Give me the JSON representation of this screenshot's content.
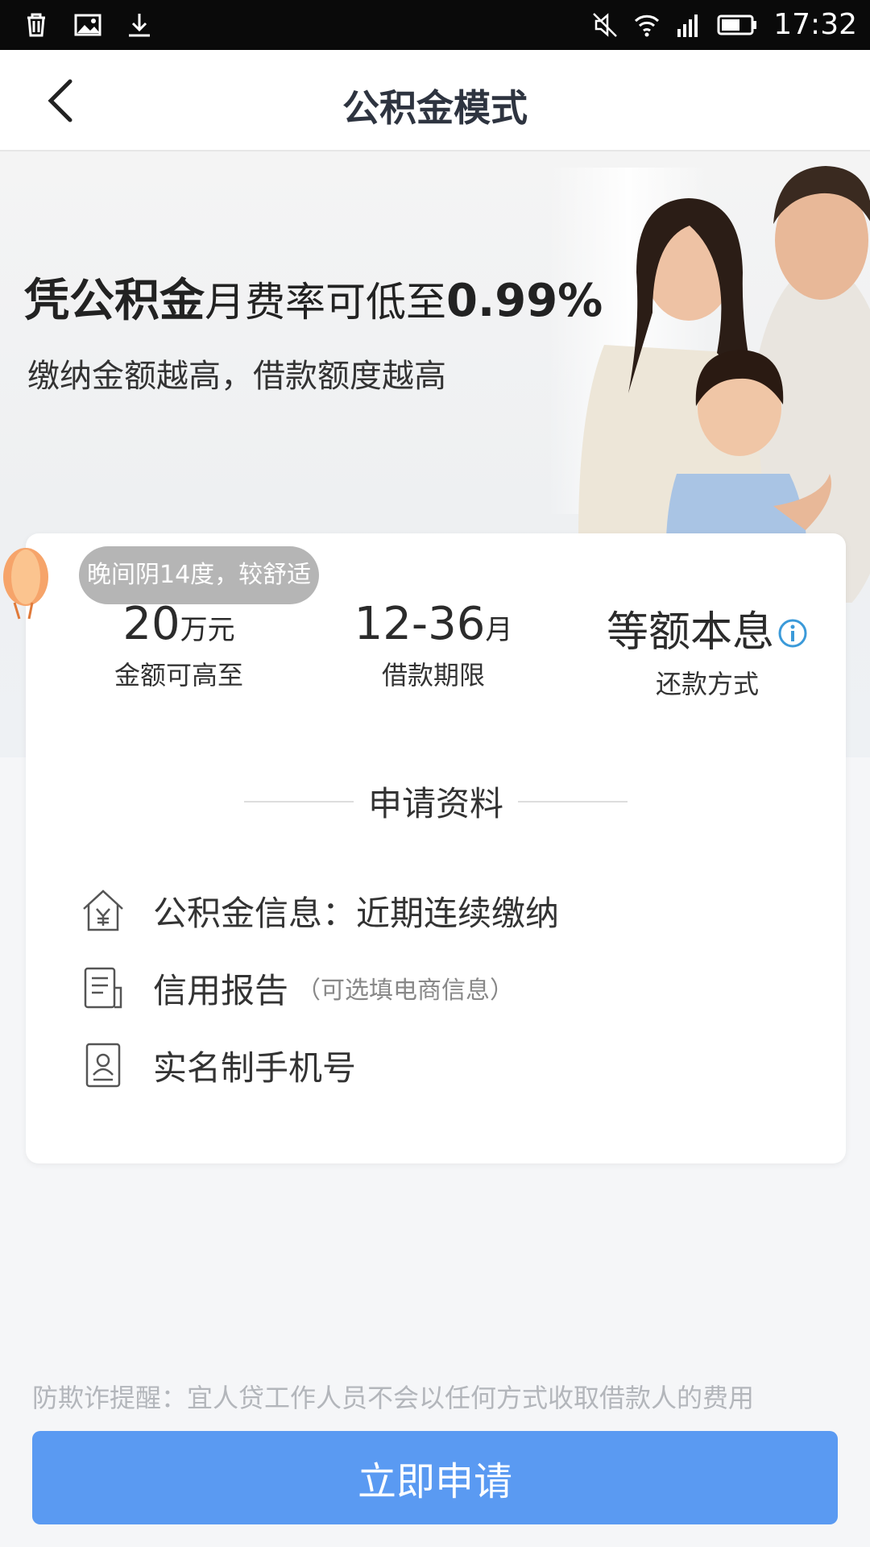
{
  "status_bar": {
    "time": "17:32",
    "left_icons": [
      "trash-icon",
      "image-icon",
      "download-icon"
    ],
    "right_icons": [
      "mute-icon",
      "wifi-icon",
      "signal-icon",
      "battery-icon"
    ]
  },
  "header": {
    "title": "公积金模式",
    "back_icon": "chevron-left-icon"
  },
  "banner": {
    "headline_strong_1": "凭公积金",
    "headline_mid": "月费率可低至",
    "headline_strong_2": "0.99%",
    "subline": "缴纳金额越高，借款额度越高"
  },
  "weather": {
    "text": "晚间阴14度，较舒适"
  },
  "stats": [
    {
      "value": "20",
      "unit": "万元",
      "label": "金额可高至"
    },
    {
      "value": "12-36",
      "unit": "月",
      "label": "借款期限"
    },
    {
      "value": "等额本息",
      "unit": "",
      "label": "还款方式",
      "icon": "info-icon"
    }
  ],
  "requirements": {
    "title": "申请资料",
    "items": [
      {
        "icon": "house-yuan-icon",
        "text": "公积金信息：近期连续缴纳",
        "note": ""
      },
      {
        "icon": "document-icon",
        "text": "信用报告",
        "note": "（可选填电商信息）"
      },
      {
        "icon": "id-phone-icon",
        "text": "实名制手机号",
        "note": ""
      }
    ]
  },
  "fraud_notice": "防欺诈提醒：宜人贷工作人员不会以任何方式收取借款人的费用",
  "apply_button": "立即申请",
  "colors": {
    "primary_button": "#5a9af2",
    "info_icon": "#3b9ad9",
    "status_bar": "#0a0a0a"
  }
}
